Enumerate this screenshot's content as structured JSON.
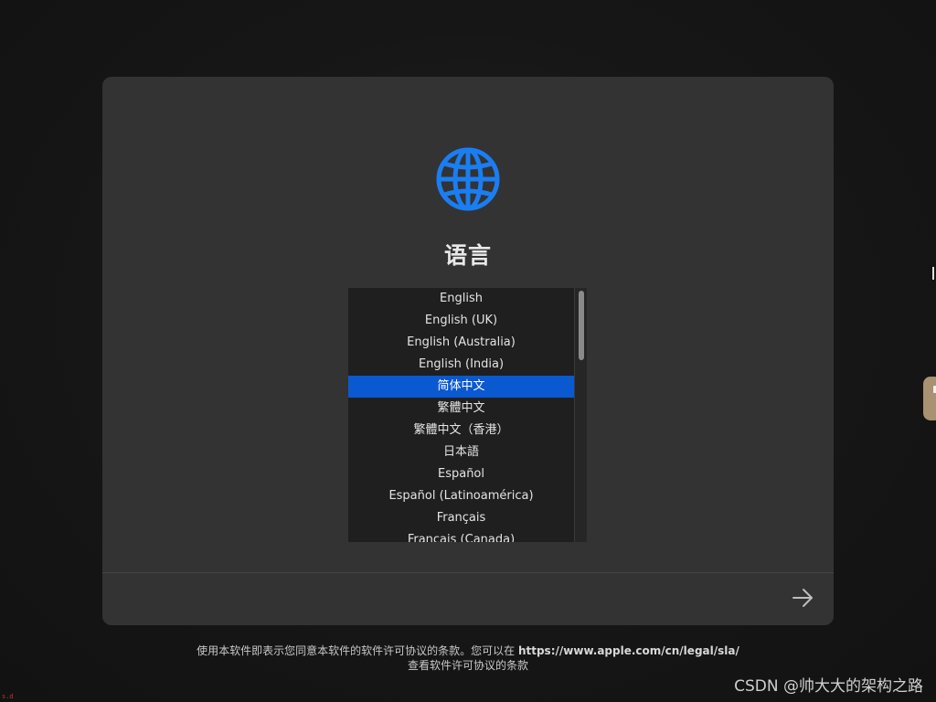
{
  "title": "语言",
  "languages": [
    "English",
    "English (UK)",
    "English (Australia)",
    "English (India)",
    "简体中文",
    "繁體中文",
    "繁體中文（香港）",
    "日本語",
    "Español",
    "Español (Latinoamérica)",
    "Français",
    "Français (Canada)"
  ],
  "selected_language": "简体中文",
  "footer": {
    "text_before_url": "使用本软件即表示您同意本软件的软件许可协议的条款。您可以在 ",
    "url": "https://www.apple.com/cn/legal/sla/",
    "line2": "查看软件许可协议的条款"
  },
  "watermark": "CSDN @帅大大的架构之路",
  "corner_mark": "s.d",
  "icons": {
    "globe": "globe-icon",
    "next": "arrow-right-icon"
  },
  "colors": {
    "accent": "#0a59d1",
    "globe": "#1a7ef2",
    "panel": "#333333",
    "background": "#141414"
  }
}
